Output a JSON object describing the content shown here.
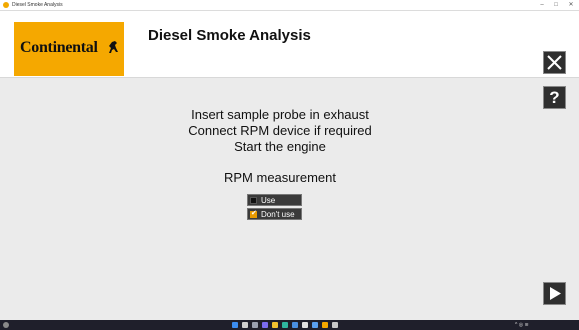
{
  "window": {
    "title": "Diesel Smoke Analysis"
  },
  "header": {
    "logo_text": "Continental",
    "title": "Diesel Smoke Analysis"
  },
  "instructions": [
    "Insert sample probe in exhaust",
    "Connect RPM device if required",
    "Start the engine"
  ],
  "rpm": {
    "title": "RPM measurement",
    "options": [
      {
        "label": "Use",
        "checked": false
      },
      {
        "label": "Don't use",
        "checked": true
      }
    ]
  },
  "controls": {
    "help_label": "?"
  },
  "colors": {
    "brand": "#f5a800",
    "button_bg": "#2f2f2f"
  }
}
